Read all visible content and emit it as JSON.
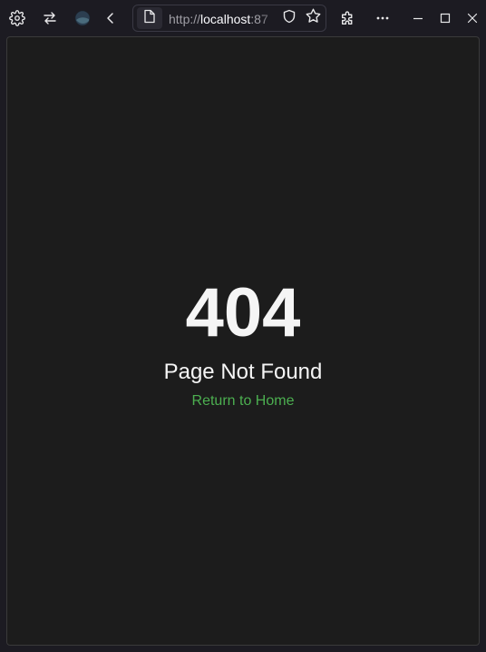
{
  "browser": {
    "url_scheme": "http://",
    "url_host": "localhost",
    "url_port_fragment": ":87",
    "toolbar_icons": [
      "settings-icon",
      "sync-icon",
      "account-avatar-icon",
      "back-icon",
      "page-icon",
      "shield-icon",
      "bookmark-star-icon",
      "extensions-icon",
      "more-menu-icon",
      "minimize-icon",
      "maximize-icon",
      "close-icon"
    ]
  },
  "page": {
    "error_code": "404",
    "error_title": "Page Not Found",
    "home_link_label": "Return to Home"
  },
  "colors": {
    "background": "#1c1c1c",
    "text": "#f5f5f5",
    "link": "#4caf50"
  }
}
